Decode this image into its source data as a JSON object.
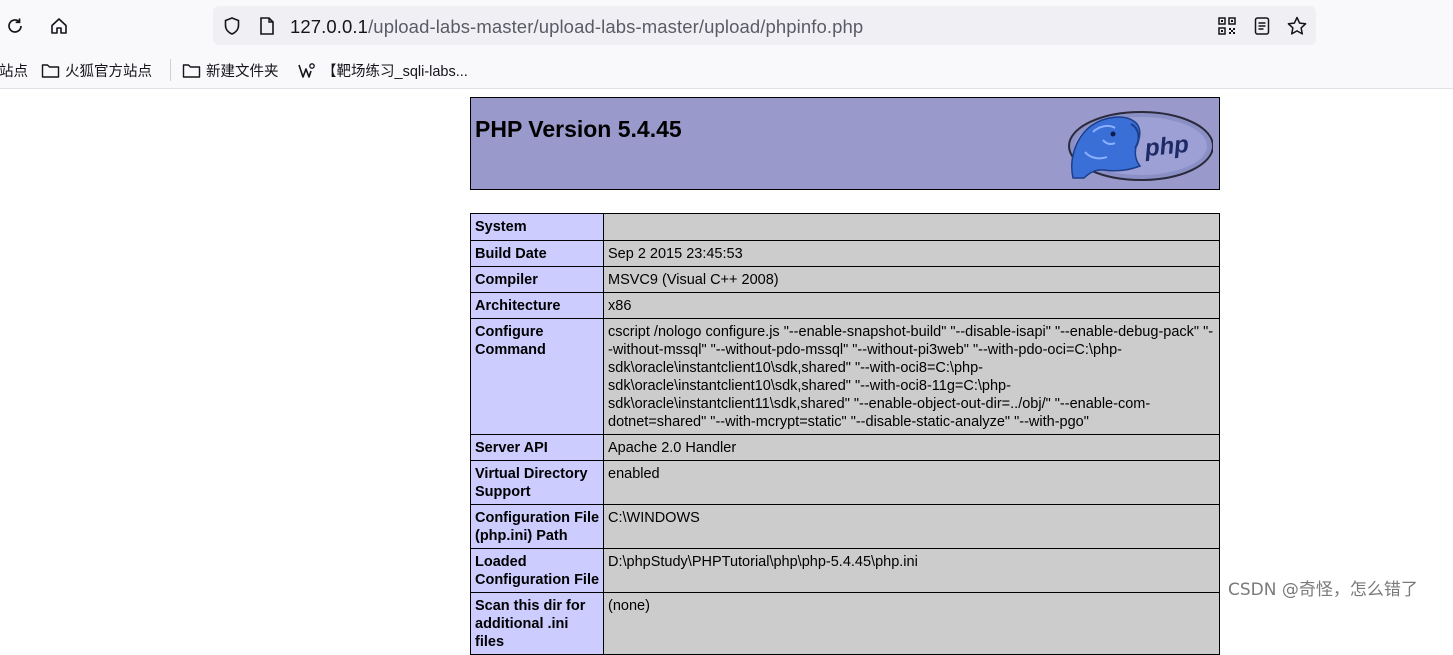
{
  "browser": {
    "url_host": "127.0.0.1",
    "url_path": "/upload-labs-master/upload-labs-master/upload/phpinfo.php",
    "bookmarks": [
      {
        "label": "站点"
      },
      {
        "label": "火狐官方站点"
      },
      {
        "label": "新建文件夹"
      },
      {
        "label": "【靶场练习_sqli-labs..."
      }
    ]
  },
  "php": {
    "title": "PHP Version 5.4.45",
    "logo_text": "php",
    "rows": [
      {
        "key": "System",
        "value": ""
      },
      {
        "key": "Build Date",
        "value": "Sep 2 2015 23:45:53"
      },
      {
        "key": "Compiler",
        "value": "MSVC9 (Visual C++ 2008)"
      },
      {
        "key": "Architecture",
        "value": "x86"
      },
      {
        "key": "Configure Command",
        "value": "cscript /nologo configure.js \"--enable-snapshot-build\" \"--disable-isapi\" \"--enable-debug-pack\" \"--without-mssql\" \"--without-pdo-mssql\" \"--without-pi3web\" \"--with-pdo-oci=C:\\php-sdk\\oracle\\instantclient10\\sdk,shared\" \"--with-oci8=C:\\php-sdk\\oracle\\instantclient10\\sdk,shared\" \"--with-oci8-11g=C:\\php-sdk\\oracle\\instantclient11\\sdk,shared\" \"--enable-object-out-dir=../obj/\" \"--enable-com-dotnet=shared\" \"--with-mcrypt=static\" \"--disable-static-analyze\" \"--with-pgo\""
      },
      {
        "key": "Server API",
        "value": "Apache 2.0 Handler"
      },
      {
        "key": "Virtual Directory Support",
        "value": "enabled"
      },
      {
        "key": "Configuration File (php.ini) Path",
        "value": "C:\\WINDOWS"
      },
      {
        "key": "Loaded Configuration File",
        "value": "D:\\phpStudy\\PHPTutorial\\php\\php-5.4.45\\php.ini"
      },
      {
        "key": "Scan this dir for additional .ini files",
        "value": "(none)"
      }
    ]
  },
  "watermark": "CSDN @奇怪，怎么错了",
  "colors": {
    "header_bg": "#9999cc",
    "key_bg": "#ccccff",
    "value_bg": "#cccccc"
  }
}
